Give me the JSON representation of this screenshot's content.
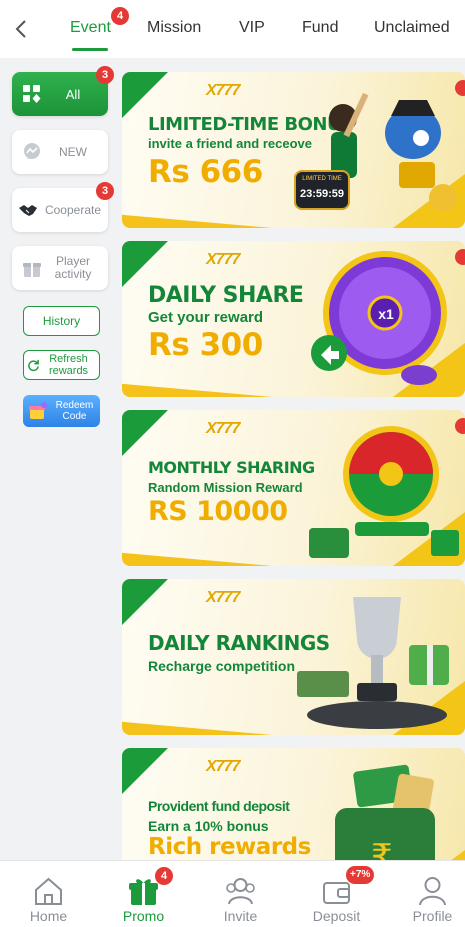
{
  "top_tabs": [
    {
      "label": "Event",
      "active": true,
      "badge": "4"
    },
    {
      "label": "Mission"
    },
    {
      "label": "VIP"
    },
    {
      "label": "Fund"
    },
    {
      "label": "Unclaimed"
    }
  ],
  "sidebar": {
    "categories": [
      {
        "label": "All",
        "badge": "3",
        "icon": "grid-icon",
        "active": true
      },
      {
        "label": "NEW",
        "icon": "chat-bubble-icon"
      },
      {
        "label": "Cooperate",
        "badge": "3",
        "icon": "handshake-icon"
      },
      {
        "label": "Player activity",
        "icon": "gift-box-icon"
      }
    ],
    "history": "History",
    "refresh": "Refresh rewards",
    "redeem": "Redeem Code"
  },
  "banners": [
    {
      "logo": "X777",
      "title": "LIMITED-TIME BONUS",
      "subtitle": "invite a friend and receove",
      "amount": "Rs 666",
      "timer_label": "LIMITED TIME",
      "timer": "23:59:59"
    },
    {
      "logo": "X777",
      "title": "DAILY SHARE",
      "subtitle": "Get your reward",
      "amount": "Rs 300",
      "wheel_center": "x1"
    },
    {
      "logo": "X777",
      "title": "MONTHLY SHARING",
      "subtitle": "Random Mission Reward",
      "amount": "RS 10000"
    },
    {
      "logo": "X777",
      "title": "DAILY RANKINGS",
      "subtitle": "Recharge competition",
      "amount": ""
    },
    {
      "logo": "X777",
      "title": "Provident fund deposit",
      "subtitle": "Earn a 10% bonus",
      "amount": "Rich rewards"
    }
  ],
  "bottom_nav": [
    {
      "label": "Home",
      "icon": "home-icon"
    },
    {
      "label": "Promo",
      "icon": "gift-icon",
      "badge": "4",
      "active": true
    },
    {
      "label": "Invite",
      "icon": "people-icon"
    },
    {
      "label": "Deposit",
      "icon": "wallet-icon",
      "badge": "+7%"
    },
    {
      "label": "Profile",
      "icon": "person-icon"
    }
  ],
  "colors": {
    "accent": "#1d9a3e",
    "badge": "#e53935",
    "gold": "#f0ad00"
  }
}
